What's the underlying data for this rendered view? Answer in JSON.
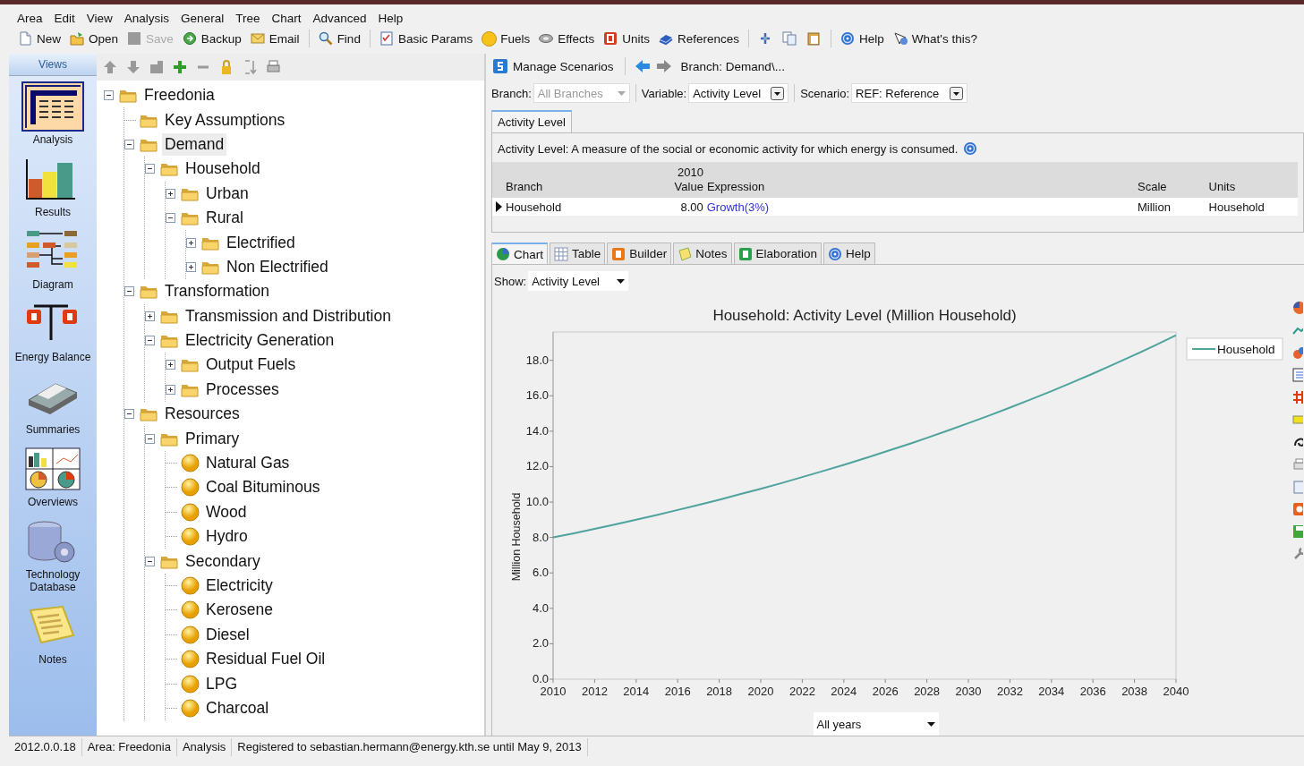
{
  "menu": [
    "Area",
    "Edit",
    "View",
    "Analysis",
    "General",
    "Tree",
    "Chart",
    "Advanced",
    "Help"
  ],
  "toolbar": {
    "groups": [
      [
        {
          "label": "New",
          "disabled": false
        },
        {
          "label": "Open",
          "disabled": false
        },
        {
          "label": "Save",
          "disabled": true
        },
        {
          "label": "Backup",
          "disabled": false
        },
        {
          "label": "Email",
          "disabled": false
        }
      ],
      [
        {
          "label": "Find",
          "disabled": false
        }
      ],
      [
        {
          "label": "Basic Params",
          "disabled": false
        },
        {
          "label": "Fuels",
          "disabled": false
        },
        {
          "label": "Effects",
          "disabled": false
        },
        {
          "label": "Units",
          "disabled": false
        },
        {
          "label": "References",
          "disabled": false
        }
      ],
      [
        {
          "disabled": false
        },
        {
          "disabled": false
        },
        {
          "disabled": false
        }
      ],
      [
        {
          "label": "Help",
          "disabled": false
        },
        {
          "label": "What's this?",
          "disabled": false
        }
      ]
    ]
  },
  "views": {
    "title": "Views",
    "items": [
      {
        "label": "Analysis",
        "selected": true
      },
      {
        "label": "Results",
        "selected": false
      },
      {
        "label": "Diagram",
        "selected": false
      },
      {
        "label": "Energy Balance",
        "selected": false
      },
      {
        "label": "Summaries",
        "selected": false
      },
      {
        "label": "Overviews",
        "selected": false
      },
      {
        "label": "Technology Database",
        "selected": false
      },
      {
        "label": "Notes",
        "selected": false
      }
    ]
  },
  "tree": {
    "nodes": [
      {
        "label": "Freedonia",
        "kind": "folder",
        "expanded": true,
        "selected": false,
        "children": [
          {
            "label": "Key Assumptions",
            "kind": "folder",
            "selected": false
          },
          {
            "label": "Demand",
            "kind": "folder",
            "expanded": true,
            "selected": true,
            "children": [
              {
                "label": "Household",
                "kind": "folder",
                "expanded": true,
                "selected": false,
                "children": [
                  {
                    "label": "Urban",
                    "kind": "folder",
                    "expanded": false,
                    "selected": false
                  },
                  {
                    "label": "Rural",
                    "kind": "folder",
                    "expanded": true,
                    "selected": false,
                    "children": [
                      {
                        "label": "Electrified",
                        "kind": "folder",
                        "expanded": false,
                        "selected": false
                      },
                      {
                        "label": "Non Electrified",
                        "kind": "folder",
                        "expanded": false,
                        "selected": false
                      }
                    ]
                  }
                ]
              }
            ]
          },
          {
            "label": "Transformation",
            "kind": "folder",
            "expanded": true,
            "selected": false,
            "children": [
              {
                "label": "Transmission and Distribution",
                "kind": "folder",
                "expanded": false,
                "selected": false
              },
              {
                "label": "Electricity Generation",
                "kind": "folder",
                "expanded": true,
                "selected": false,
                "children": [
                  {
                    "label": "Output Fuels",
                    "kind": "folder",
                    "expanded": false,
                    "selected": false
                  },
                  {
                    "label": "Processes",
                    "kind": "folder",
                    "expanded": false,
                    "selected": false
                  }
                ]
              }
            ]
          },
          {
            "label": "Resources",
            "kind": "folder",
            "expanded": true,
            "selected": false,
            "children": [
              {
                "label": "Primary",
                "kind": "folder",
                "expanded": true,
                "selected": false,
                "children": [
                  {
                    "label": "Natural Gas",
                    "kind": "fuel",
                    "selected": false
                  },
                  {
                    "label": "Coal Bituminous",
                    "kind": "fuel",
                    "selected": false
                  },
                  {
                    "label": "Wood",
                    "kind": "fuel",
                    "selected": false
                  },
                  {
                    "label": "Hydro",
                    "kind": "fuel",
                    "selected": false
                  }
                ]
              },
              {
                "label": "Secondary",
                "kind": "folder",
                "expanded": true,
                "selected": false,
                "children": [
                  {
                    "label": "Electricity",
                    "kind": "fuel",
                    "selected": false
                  },
                  {
                    "label": "Kerosene",
                    "kind": "fuel",
                    "selected": false
                  },
                  {
                    "label": "Diesel",
                    "kind": "fuel",
                    "selected": false
                  },
                  {
                    "label": "Residual Fuel Oil",
                    "kind": "fuel",
                    "selected": false
                  },
                  {
                    "label": "LPG",
                    "kind": "fuel",
                    "selected": false
                  },
                  {
                    "label": "Charcoal",
                    "kind": "fuel",
                    "selected": false
                  }
                ]
              }
            ]
          }
        ]
      }
    ]
  },
  "nav": {
    "manage": "Manage Scenarios",
    "breadcrumb": "Branch: Demand\\..."
  },
  "selectors": [
    {
      "label": "Branch:",
      "value": "All Branches",
      "disabled": true
    },
    {
      "label": "Variable:",
      "value": "Activity Level",
      "disabled": false
    },
    {
      "label": "Scenario:",
      "value": "REF: Reference",
      "disabled": false
    }
  ],
  "variable_tabs": [
    {
      "label": "Activity Level",
      "selected": true
    }
  ],
  "description": "Activity Level: A measure of the social or economic activity for which energy is consumed.",
  "table": {
    "columns": [
      "Branch",
      "2010 Value",
      "Expression",
      "Scale",
      "Units"
    ],
    "rows": [
      {
        "selected": true,
        "cells": [
          "Household",
          "8.00",
          "Growth(3%)",
          "Million",
          "Household"
        ]
      }
    ]
  },
  "view_tabs": [
    {
      "label": "Chart",
      "selected": true
    },
    {
      "label": "Table",
      "selected": false
    },
    {
      "label": "Builder",
      "selected": false
    },
    {
      "label": "Notes",
      "selected": false
    },
    {
      "label": "Elaboration",
      "selected": false
    },
    {
      "label": "Help",
      "selected": false
    }
  ],
  "show": {
    "label": "Show:",
    "value": "Activity Level"
  },
  "chart": {
    "chart_data": {
      "type": "line",
      "title": "Household: Activity Level (Million Household)",
      "ylabel": "Million Household",
      "x": [
        2010,
        2011,
        2012,
        2013,
        2014,
        2015,
        2016,
        2017,
        2018,
        2019,
        2020,
        2021,
        2022,
        2023,
        2024,
        2025,
        2026,
        2027,
        2028,
        2029,
        2030,
        2031,
        2032,
        2033,
        2034,
        2035,
        2036,
        2037,
        2038,
        2039,
        2040
      ],
      "series": [
        {
          "name": "Household",
          "color": "#4ea39d",
          "values": [
            8.0,
            8.24,
            8.49,
            8.74,
            9.0,
            9.27,
            9.55,
            9.84,
            10.13,
            10.44,
            10.75,
            11.07,
            11.41,
            11.75,
            12.1,
            12.46,
            12.84,
            13.22,
            13.62,
            14.03,
            14.45,
            14.88,
            15.33,
            15.79,
            16.26,
            16.75,
            17.25,
            17.77,
            18.3,
            18.85,
            19.42
          ]
        }
      ],
      "xlim": [
        2010,
        2040
      ],
      "ylim": [
        0,
        19.6
      ],
      "xticks": [
        2010,
        2012,
        2014,
        2016,
        2018,
        2020,
        2022,
        2024,
        2026,
        2028,
        2030,
        2032,
        2034,
        2036,
        2038,
        2040
      ],
      "yticks": [
        {
          "value": 0,
          "label": "0.0"
        },
        {
          "value": 2,
          "label": "2.0"
        },
        {
          "value": 4,
          "label": "4.0"
        },
        {
          "value": 6,
          "label": "6.0"
        },
        {
          "value": 8,
          "label": "8.0"
        },
        {
          "value": 10,
          "label": "10.0"
        },
        {
          "value": 12,
          "label": "12.0"
        },
        {
          "value": 14,
          "label": "14.0"
        },
        {
          "value": 16,
          "label": "16.0"
        },
        {
          "value": 18,
          "label": "18.0"
        }
      ]
    },
    "years": "All years"
  },
  "status_bar": [
    "2012.0.0.18",
    "Area: Freedonia",
    "Analysis",
    "Registered to sebastian.hermann@energy.kth.se until May 9, 2013"
  ]
}
